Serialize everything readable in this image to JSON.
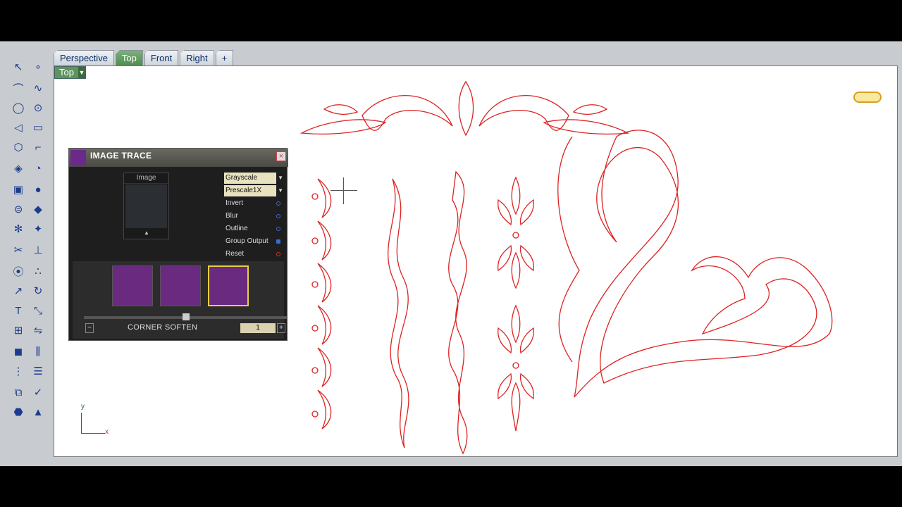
{
  "tabs": [
    "Perspective",
    "Top",
    "Front",
    "Right",
    "+"
  ],
  "viewport": {
    "label": "Top",
    "axis_x": "x",
    "axis_y": "y"
  },
  "panel": {
    "title": "IMAGE TRACE",
    "close": "×",
    "image_label": "Image",
    "options": [
      {
        "label": "Grayscale",
        "dropdown": true
      },
      {
        "label": "Prescale1X",
        "dropdown": true
      },
      {
        "label": "Invert"
      },
      {
        "label": "Blur"
      },
      {
        "label": "Outline"
      },
      {
        "label": "Group Output"
      },
      {
        "label": "Reset"
      }
    ],
    "corner_soften_label": "CORNER SOFTEN",
    "corner_soften_value": "1",
    "minus": "−",
    "plus": "+"
  },
  "colors": {
    "accent": "#5d945d",
    "curve": "#d22",
    "panel": "#1e1e1e"
  }
}
